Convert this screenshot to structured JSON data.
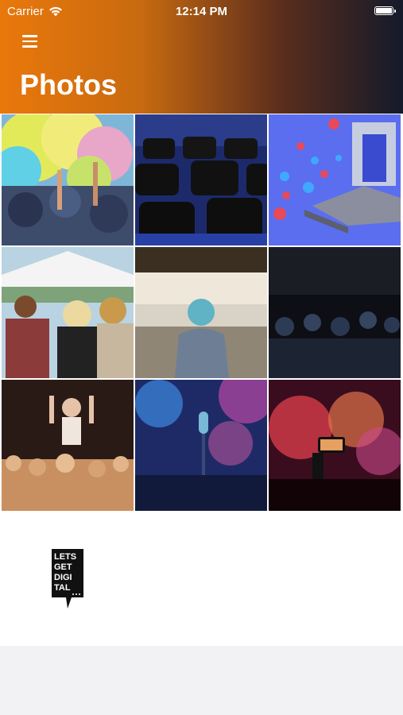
{
  "status_bar": {
    "carrier": "Carrier",
    "time": "12:14 PM",
    "wifi_icon": "wifi-icon",
    "battery_icon": "battery-icon"
  },
  "header": {
    "menu_icon": "hamburger-menu-icon",
    "title": "Photos"
  },
  "photos": [
    "holi-color-powder-crowd-photo",
    "empty-auditorium-chairs-photo",
    "social-reactions-stage-illustration",
    "outdoor-festival-crowd-photo",
    "conference-speaker-audience-photo",
    "dark-concert-audience-photo",
    "crowd-surfing-concert-photo",
    "microphone-stage-lights-photo",
    "phone-recording-concert-photo"
  ],
  "logo": {
    "lines": [
      "LETS",
      "GET",
      "DIGI",
      "TAL"
    ]
  }
}
